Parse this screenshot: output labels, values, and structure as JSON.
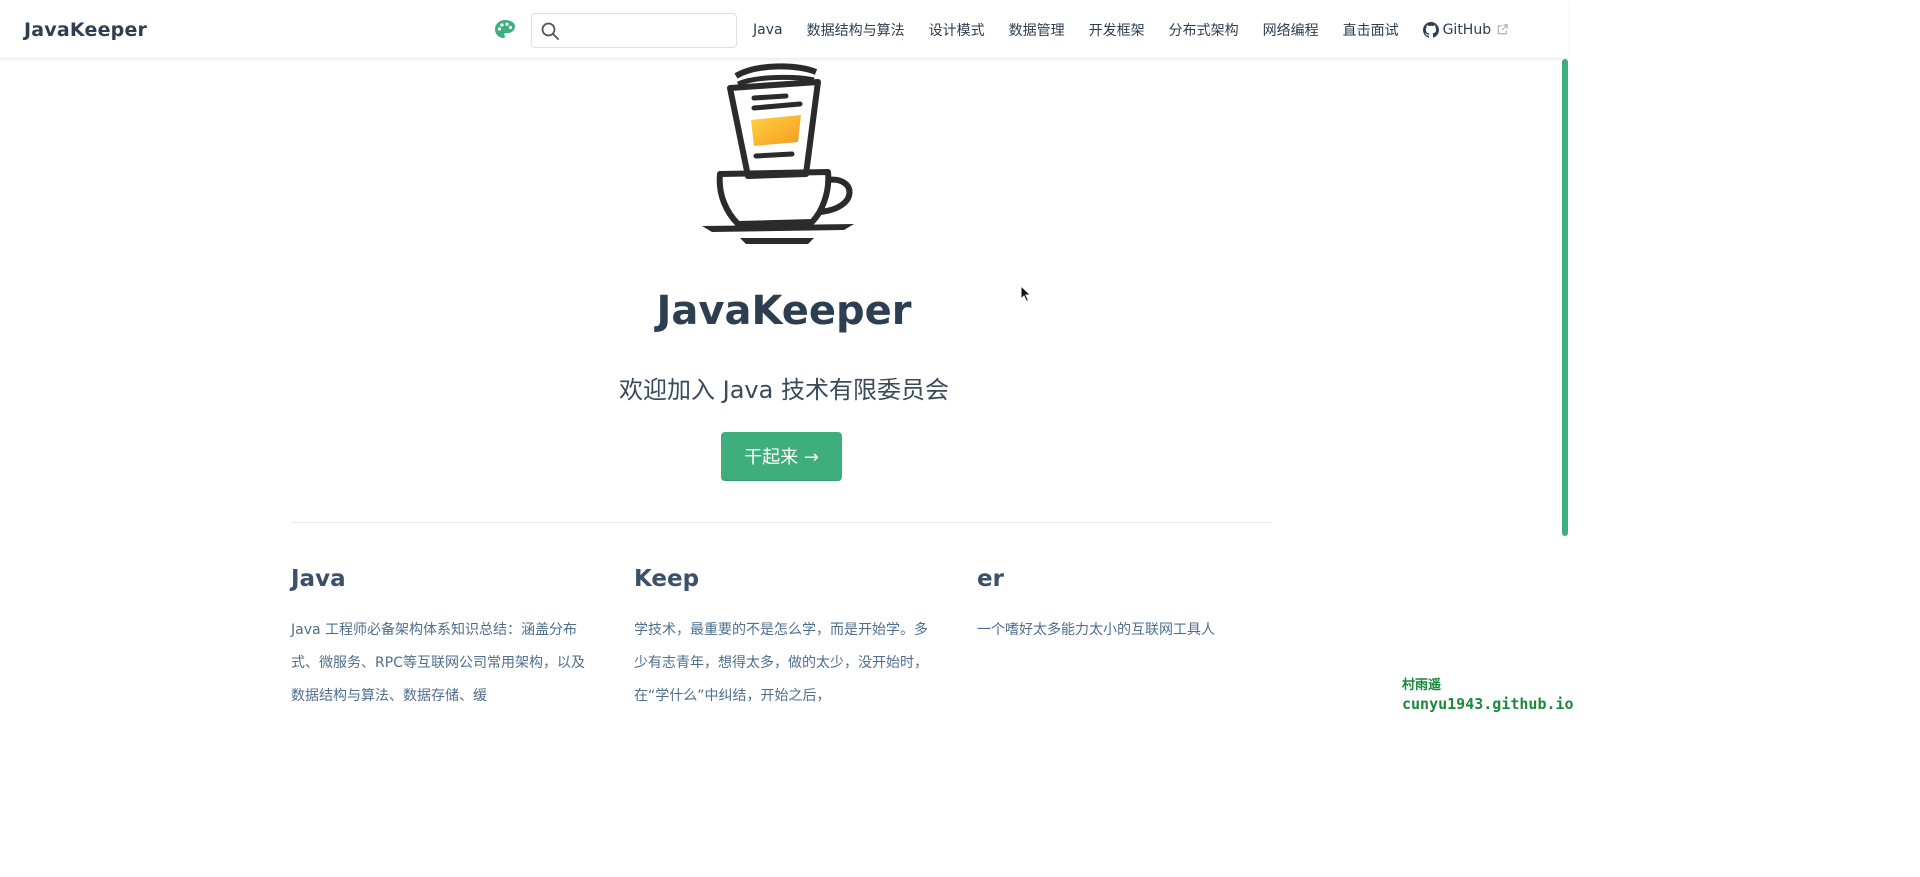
{
  "navbar": {
    "site_name": "JavaKeeper",
    "search": {
      "placeholder": "",
      "value": ""
    },
    "links": [
      {
        "label": "Java"
      },
      {
        "label": "数据结构与算法"
      },
      {
        "label": "设计模式"
      },
      {
        "label": "数据管理"
      },
      {
        "label": "开发框架"
      },
      {
        "label": "分布式架构"
      },
      {
        "label": "网络编程"
      },
      {
        "label": "直击面试"
      }
    ],
    "github_label": "GitHub"
  },
  "hero": {
    "title": "JavaKeeper",
    "description": "欢迎加入 Java 技术有限委员会",
    "action_label": "干起来 →"
  },
  "features": [
    {
      "title": "Java",
      "details": "Java 工程师必备架构体系知识总结：涵盖分布式、微服务、RPC等互联网公司常用架构，以及数据结构与算法、数据存储、缓"
    },
    {
      "title": "Keep",
      "details": "学技术，最重要的不是怎么学，而是开始学。多少有志青年，想得太多，做的太少，没开始时，在“学什么”中纠结，开始之后，"
    },
    {
      "title": "er",
      "details": "一个嗜好太多能力太小的互联网工具人"
    }
  ],
  "watermark": {
    "line1": "村雨遥",
    "line2": "cunyu1943.github.io"
  },
  "colors": {
    "accent": "#3eaf7c",
    "text": "#2c3e50",
    "logo_fill": "#f5a623"
  },
  "icons": [
    "palette-icon",
    "search-icon",
    "github-icon",
    "external-link-icon",
    "coffee-logo",
    "cursor-icon"
  ]
}
